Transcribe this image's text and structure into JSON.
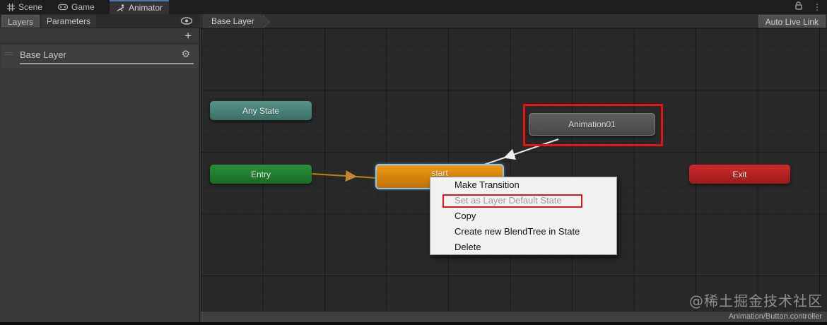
{
  "window_tabs": {
    "scene": "Scene",
    "game": "Game",
    "animator": "Animator"
  },
  "top_icons": {
    "lock": "unlocked-padlock",
    "more": "⋮"
  },
  "toolbar": {
    "layers_tab": "Layers",
    "parameters_tab": "Parameters",
    "breadcrumb": "Base Layer",
    "auto_live_link": "Auto Live Link"
  },
  "layers_panel": {
    "add_button": "+",
    "layer": {
      "name": "Base Layer",
      "gear_icon": "⚙"
    }
  },
  "graph": {
    "states": {
      "any": "Any State",
      "entry": "Entry",
      "selected": "start",
      "animation": "Animation01",
      "exit": "Exit"
    },
    "transitions": [
      {
        "from": "Entry",
        "to": "start",
        "color": "#b8860b"
      },
      {
        "from": "Animation01",
        "to": "start",
        "color": "#e8e8e8"
      }
    ]
  },
  "context_menu": {
    "items": [
      {
        "label": "Make Transition",
        "enabled": true
      },
      {
        "label": "Set as Layer Default State",
        "enabled": false,
        "annotated": true
      },
      {
        "label": "Copy",
        "enabled": true
      },
      {
        "label": "Create new BlendTree in State",
        "enabled": true
      },
      {
        "label": "Delete",
        "enabled": true
      }
    ]
  },
  "watermark": "@稀土掘金技术社区",
  "status_bar": {
    "path": "Animation/Button.controller"
  },
  "colors": {
    "annotation_red": "#e21414",
    "any_state_teal": "#4e8f82",
    "entry_green": "#23852f",
    "selected_orange": "#e08a10",
    "state_gray": "#535353",
    "exit_red": "#b42222",
    "selection_outline_blue": "#8ec7ee",
    "grid_background": "#292929"
  }
}
